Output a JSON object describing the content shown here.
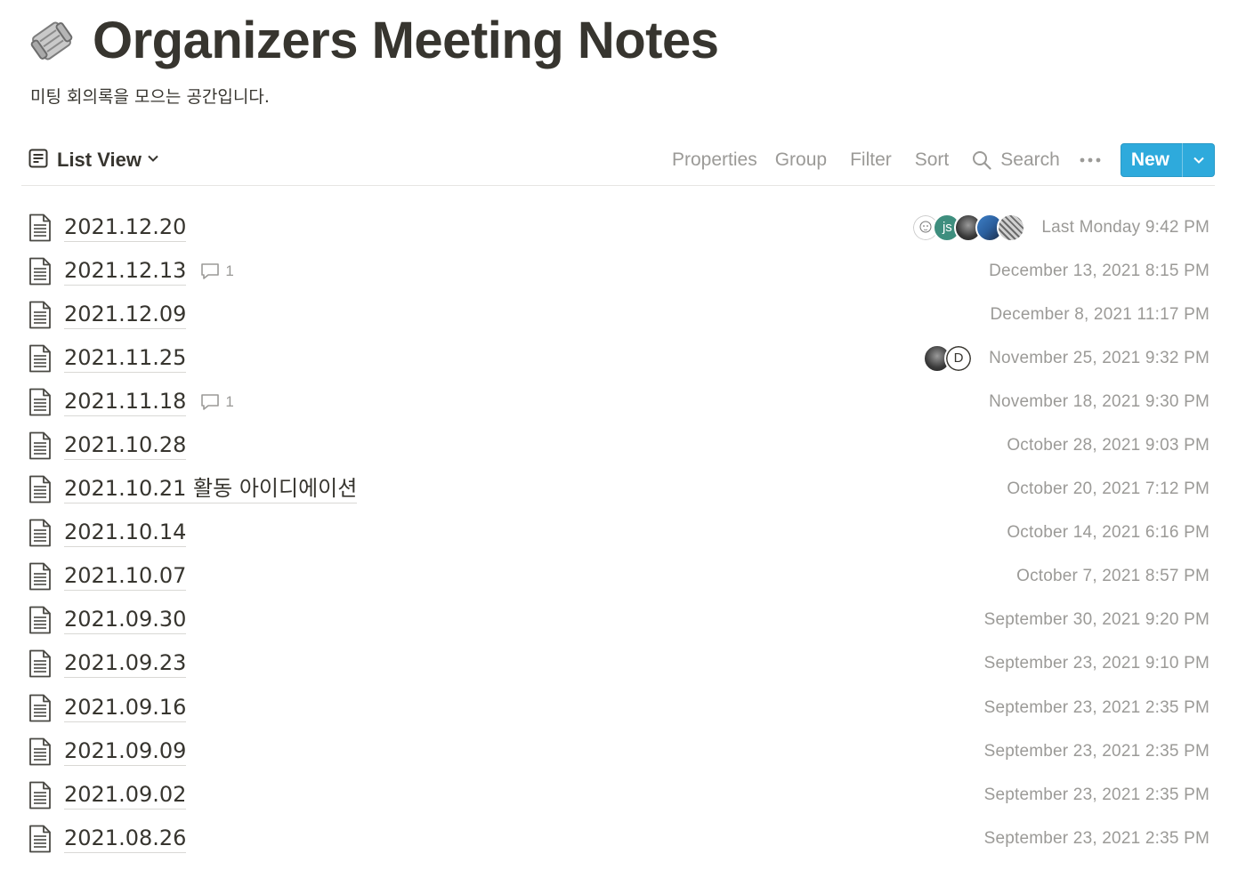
{
  "page": {
    "title": "Organizers Meeting Notes",
    "description": "미팅 회의록을 모으는 공간입니다.",
    "icon": "rolled-newspaper-icon"
  },
  "toolbar": {
    "view_label": "List View",
    "properties_label": "Properties",
    "group_label": "Group",
    "filter_label": "Filter",
    "sort_label": "Sort",
    "search_label": "Search",
    "new_label": "New"
  },
  "colors": {
    "accent": "#2eaadc",
    "text": "#37352f",
    "muted": "#9b9a97",
    "avatar_js": "#3e8e7e"
  },
  "rows": [
    {
      "title": "2021.12.20",
      "comments": "",
      "edited": "Last Monday 9:42 PM",
      "avatars": [
        "sketch",
        "js",
        "dark",
        "blue",
        "pattern"
      ]
    },
    {
      "title": "2021.12.13",
      "comments": "1",
      "edited": "December 13, 2021 8:15 PM",
      "avatars": []
    },
    {
      "title": "2021.12.09",
      "comments": "",
      "edited": "December 8, 2021 11:17 PM",
      "avatars": []
    },
    {
      "title": "2021.11.25",
      "comments": "",
      "edited": "November 25, 2021 9:32 PM",
      "avatars": [
        "dark",
        "D"
      ]
    },
    {
      "title": "2021.11.18",
      "comments": "1",
      "edited": "November 18, 2021 9:30 PM",
      "avatars": []
    },
    {
      "title": "2021.10.28",
      "comments": "",
      "edited": "October 28, 2021 9:03 PM",
      "avatars": []
    },
    {
      "title": "2021.10.21 활동 아이디에이션",
      "comments": "",
      "edited": "October 20, 2021 7:12 PM",
      "avatars": []
    },
    {
      "title": "2021.10.14",
      "comments": "",
      "edited": "October 14, 2021 6:16 PM",
      "avatars": []
    },
    {
      "title": "2021.10.07",
      "comments": "",
      "edited": "October 7, 2021 8:57 PM",
      "avatars": []
    },
    {
      "title": "2021.09.30",
      "comments": "",
      "edited": "September 30, 2021 9:20 PM",
      "avatars": []
    },
    {
      "title": "2021.09.23",
      "comments": "",
      "edited": "September 23, 2021 9:10 PM",
      "avatars": []
    },
    {
      "title": "2021.09.16",
      "comments": "",
      "edited": "September 23, 2021 2:35 PM",
      "avatars": []
    },
    {
      "title": "2021.09.09",
      "comments": "",
      "edited": "September 23, 2021 2:35 PM",
      "avatars": []
    },
    {
      "title": "2021.09.02",
      "comments": "",
      "edited": "September 23, 2021 2:35 PM",
      "avatars": []
    },
    {
      "title": "2021.08.26",
      "comments": "",
      "edited": "September 23, 2021 2:35 PM",
      "avatars": []
    }
  ]
}
